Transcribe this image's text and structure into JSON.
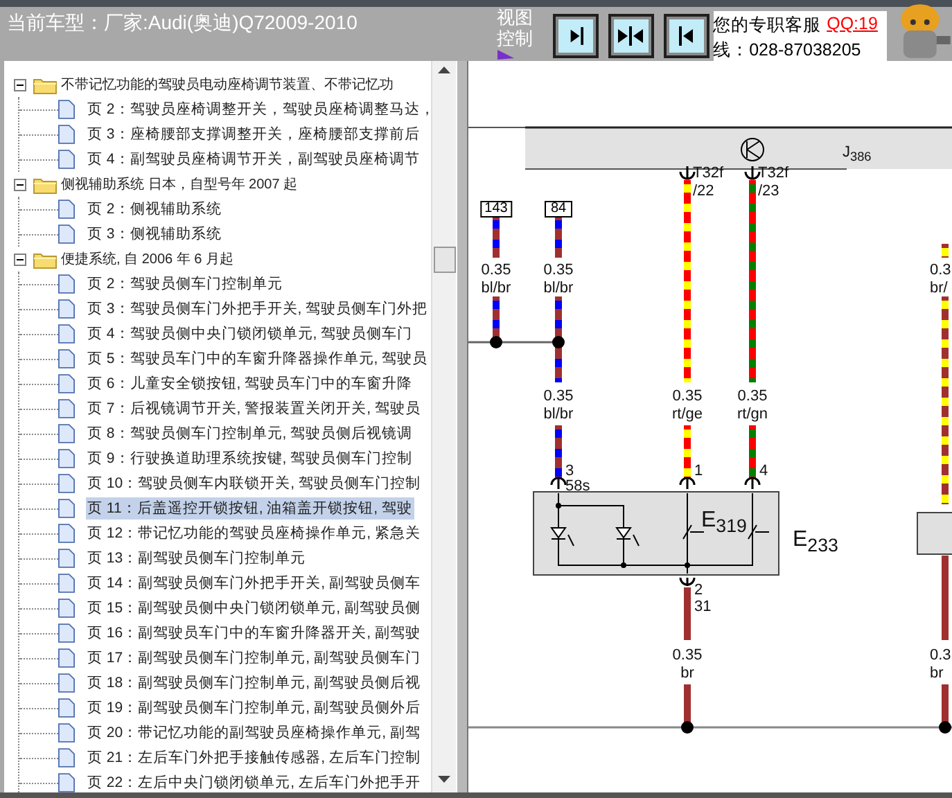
{
  "header": {
    "car_model": "当前车型：厂家:Audi(奥迪)Q72009-2010",
    "view_control": "视图控制",
    "view_buttons": [
      {
        "kind": "right"
      },
      {
        "kind": "both"
      },
      {
        "kind": "left"
      }
    ],
    "service": "您的专职客服",
    "qq": "QQ:19",
    "phone": "线：028-87038205"
  },
  "tree": [
    {
      "label": "不带记忆功能的驾驶员电动座椅调节装置、不带记忆功",
      "expanded": true,
      "children": [
        {
          "label": "页 2：驾驶员座椅调整开关，驾驶员座椅调整马达，",
          "selected": false
        },
        {
          "label": "页 3：座椅腰部支撑调整开关，座椅腰部支撑前后",
          "selected": false
        },
        {
          "label": "页 4：副驾驶员座椅调节开关，副驾驶员座椅调节",
          "selected": false
        }
      ]
    },
    {
      "label": "侧视辅助系统 日本，自型号年 2007 起",
      "expanded": true,
      "children": [
        {
          "label": "页 2：侧视辅助系统",
          "selected": false
        },
        {
          "label": "页 3：侧视辅助系统",
          "selected": false
        }
      ]
    },
    {
      "label": "便捷系统, 自 2006 年 6 月起",
      "expanded": true,
      "children": [
        {
          "label": "页 2：驾驶员侧车门控制单元",
          "selected": false
        },
        {
          "label": "页 3：驾驶员侧车门外把手开关, 驾驶员侧车门外把",
          "selected": false
        },
        {
          "label": "页 4：驾驶员侧中央门锁闭锁单元, 驾驶员侧车门",
          "selected": false
        },
        {
          "label": "页 5：驾驶员车门中的车窗升降器操作单元, 驾驶员",
          "selected": false
        },
        {
          "label": "页 6：儿童安全锁按钮, 驾驶员车门中的车窗升降",
          "selected": false
        },
        {
          "label": "页 7：后视镜调节开关, 警报装置关闭开关, 驾驶员",
          "selected": false
        },
        {
          "label": "页 8：驾驶员侧车门控制单元, 驾驶员侧后视镜调",
          "selected": false
        },
        {
          "label": "页 9：行驶换道助理系统按键, 驾驶员侧车门控制",
          "selected": false
        },
        {
          "label": "页 10：驾驶员侧车内联锁开关, 驾驶员侧车门控制",
          "selected": false
        },
        {
          "label": "页 11：后盖遥控开锁按钮, 油箱盖开锁按钮, 驾驶",
          "selected": true
        },
        {
          "label": "页 12：带记忆功能的驾驶员座椅操作单元, 紧急关",
          "selected": false
        },
        {
          "label": "页 13：副驾驶员侧车门控制单元",
          "selected": false
        },
        {
          "label": "页 14：副驾驶员侧车门外把手开关, 副驾驶员侧车",
          "selected": false
        },
        {
          "label": "页 15：副驾驶员侧中央门锁闭锁单元, 副驾驶员侧",
          "selected": false
        },
        {
          "label": "页 16：副驾驶员车门中的车窗升降器开关, 副驾驶",
          "selected": false
        },
        {
          "label": "页 17：副驾驶员侧车门控制单元, 副驾驶员侧车门",
          "selected": false
        },
        {
          "label": "页 18：副驾驶员侧车门控制单元, 副驾驶员侧后视",
          "selected": false
        },
        {
          "label": "页 19：副驾驶员侧车门控制单元, 副驾驶员侧外后",
          "selected": false
        },
        {
          "label": "页 20：带记忆功能的副驾驶员座椅操作单元, 副驾",
          "selected": false
        },
        {
          "label": "页 21：左后车门外把手接触传感器, 左后车门控制",
          "selected": false
        },
        {
          "label": "页 22：左后中央门锁闭锁单元, 左后车门外把手开",
          "selected": false
        }
      ]
    }
  ],
  "diagram": {
    "control_unit": "J$_{386}$",
    "wires": [
      {
        "tag": "143",
        "color": "#a0302f",
        "stripes": [
          {
            "color": "#0000ff"
          }
        ],
        "labels": [
          {
            "size": "0.35",
            "code": "bl/br"
          }
        ]
      },
      {
        "tag": "84",
        "pin": "3",
        "terminal": "58s",
        "color": "#a0302f",
        "stripes": [
          {
            "color": "#0000ff"
          }
        ],
        "labels": [
          {
            "size": "0.35",
            "code": "bl/br"
          },
          {
            "size": "0.35",
            "code": "bl/br"
          }
        ]
      },
      {
        "connector": "T32f",
        "connector_pin": "/22",
        "pin": "1",
        "color": "#ff0000",
        "stripes": [
          {
            "color": "#ffff00"
          }
        ],
        "labels": [
          {
            "size": "0.35",
            "code": "rt/ge"
          }
        ]
      },
      {
        "connector": "T32f",
        "connector_pin": "/23",
        "pin": "4",
        "color": "#ff0000",
        "stripes": [
          {
            "color": "#008000"
          }
        ],
        "labels": [
          {
            "size": "0.35",
            "code": "rt/gn"
          }
        ]
      },
      {
        "color": "#a0302f",
        "stripes": [
          {
            "color": "#ffff00"
          }
        ],
        "labels": [
          {
            "size": "0.3",
            "code": "br/"
          }
        ]
      },
      {
        "pin": "2",
        "terminal": "31",
        "color": "#a0302f",
        "labels": [
          {
            "size": "0.35",
            "code": "br"
          }
        ]
      },
      {
        "color": "#a0302f",
        "labels": [
          {
            "size": "0.3",
            "code": "br"
          }
        ]
      }
    ],
    "components": [
      {
        "label": "E$_{319}$"
      },
      {
        "label": "E$_{233}$"
      }
    ]
  }
}
